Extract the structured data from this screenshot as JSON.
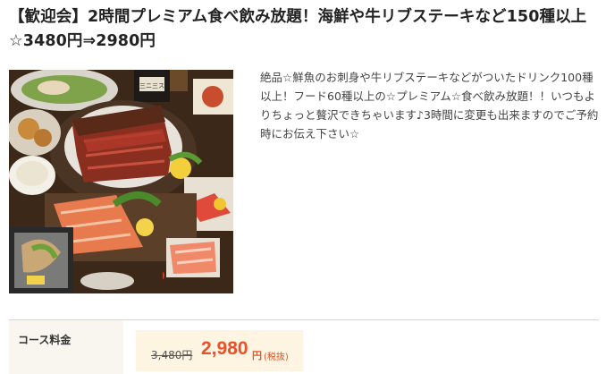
{
  "course": {
    "title": "【歓迎会】2時間プレミアム食べ飲み放題！海鮮や牛リブステーキなど150種以上☆3480円⇒2980円",
    "description": "絶品☆鮮魚のお刺身や牛リブステーキなどがついたドリンク100種以上！フード60種以上の☆プレミアム☆食べ飲み放題！！いつもよりちょっと贅沢できちゃいます♪3時間に変更も出来ますのでご予約時にお伝え下さい☆",
    "photo_bottle_label": "三ニ三ス"
  },
  "pricing": {
    "label": "コース料金",
    "original_price": "3,480円",
    "sale_price": "2,980",
    "currency_unit": "円",
    "tax_note": "(税抜)"
  },
  "colors": {
    "sale_price": "#e8522a",
    "price_box_bg": "#fdf4e1",
    "label_cell_bg": "#f8f6ef",
    "divider": "#d9d4c6"
  }
}
